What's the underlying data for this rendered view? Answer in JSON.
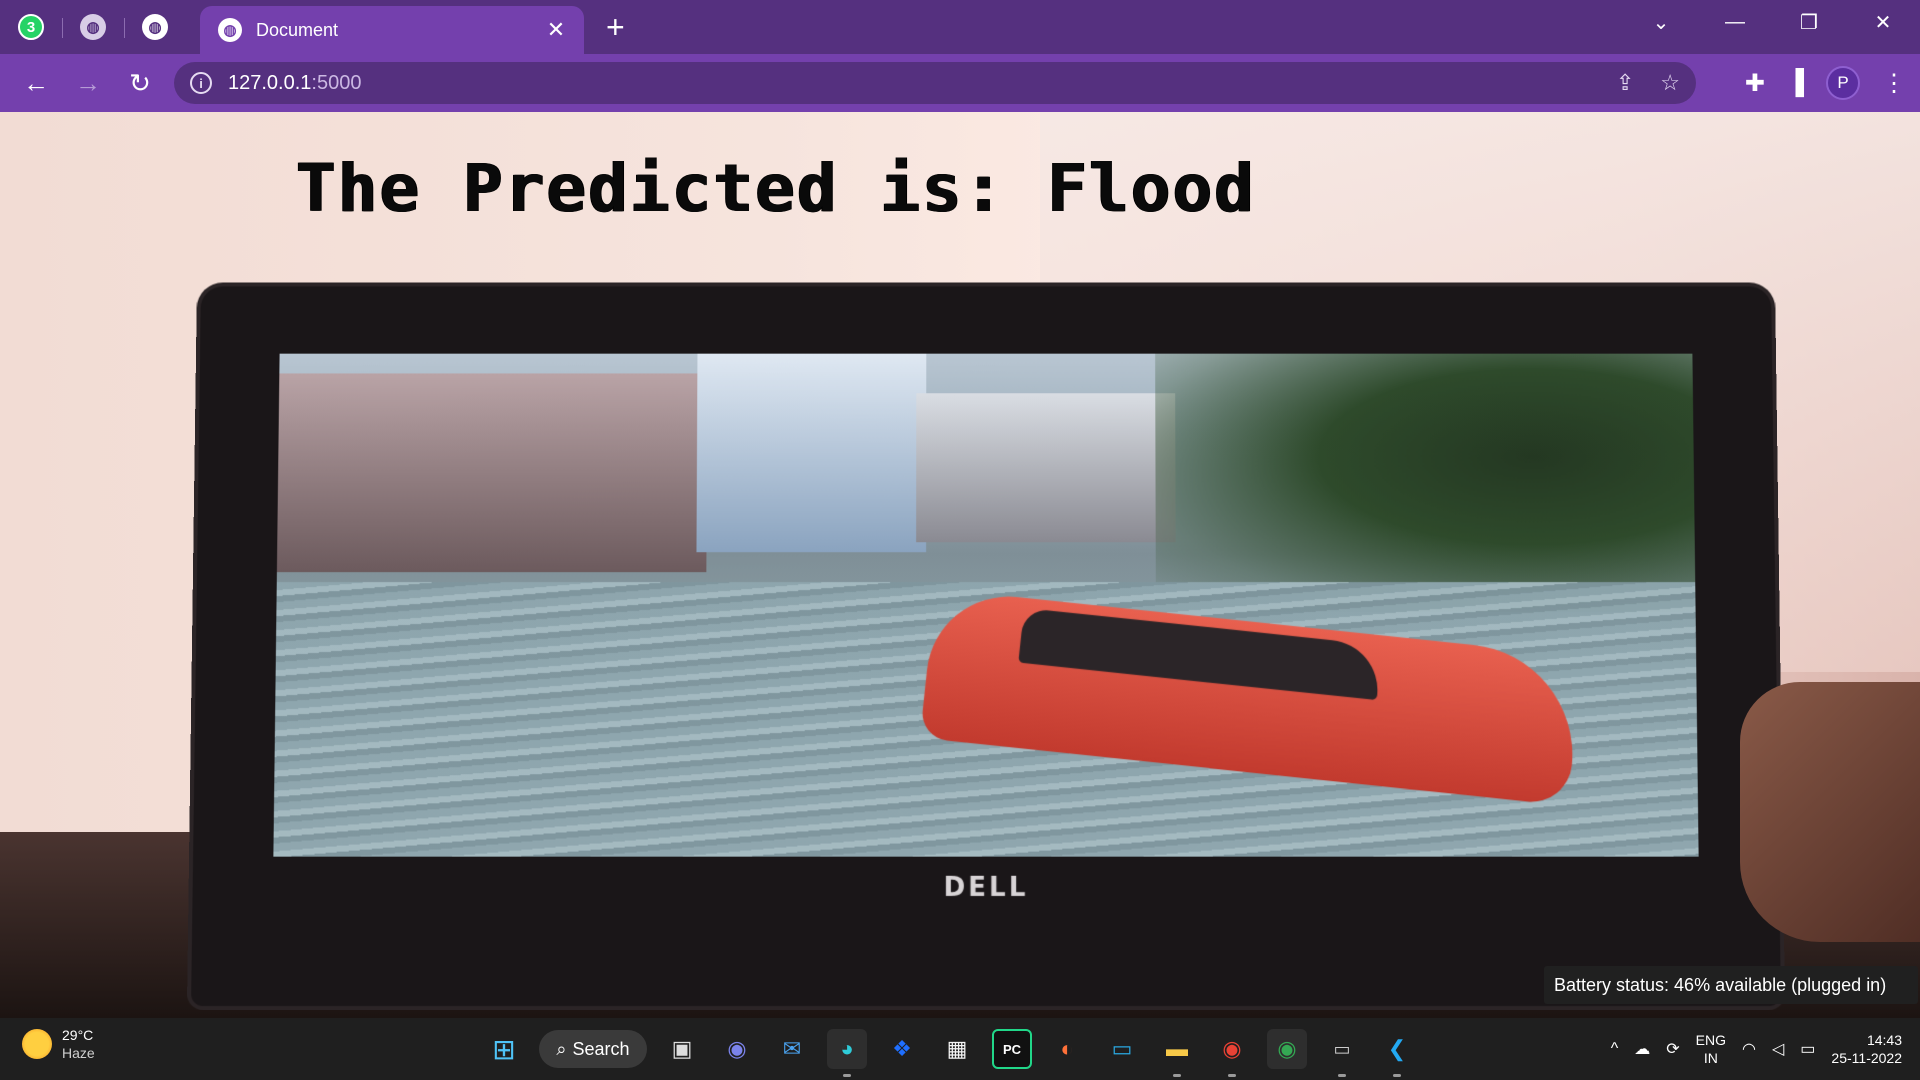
{
  "browser": {
    "pinned_tabs": [
      {
        "icon": "whatsapp-icon",
        "badge": "3"
      },
      {
        "icon": "globe-icon"
      },
      {
        "icon": "globe-icon"
      }
    ],
    "active_tab": {
      "title": "Document",
      "icon": "globe-icon"
    },
    "url_host": "127.0.0.1",
    "url_port": ":5000",
    "profile_initial": "P",
    "accent_color": "#7440ad",
    "tabbar_color": "#55307f"
  },
  "page": {
    "prediction_text": "The Predicted is: Flood",
    "laptop_brand": "DELL"
  },
  "tooltip": {
    "battery": "Battery status: 46% available (plugged in)"
  },
  "taskbar": {
    "weather_temp": "29°C",
    "weather_condition": "Haze",
    "search_label": "Search",
    "lang_line1": "ENG",
    "lang_line2": "IN",
    "time": "14:43",
    "date": "25-11-2022"
  }
}
